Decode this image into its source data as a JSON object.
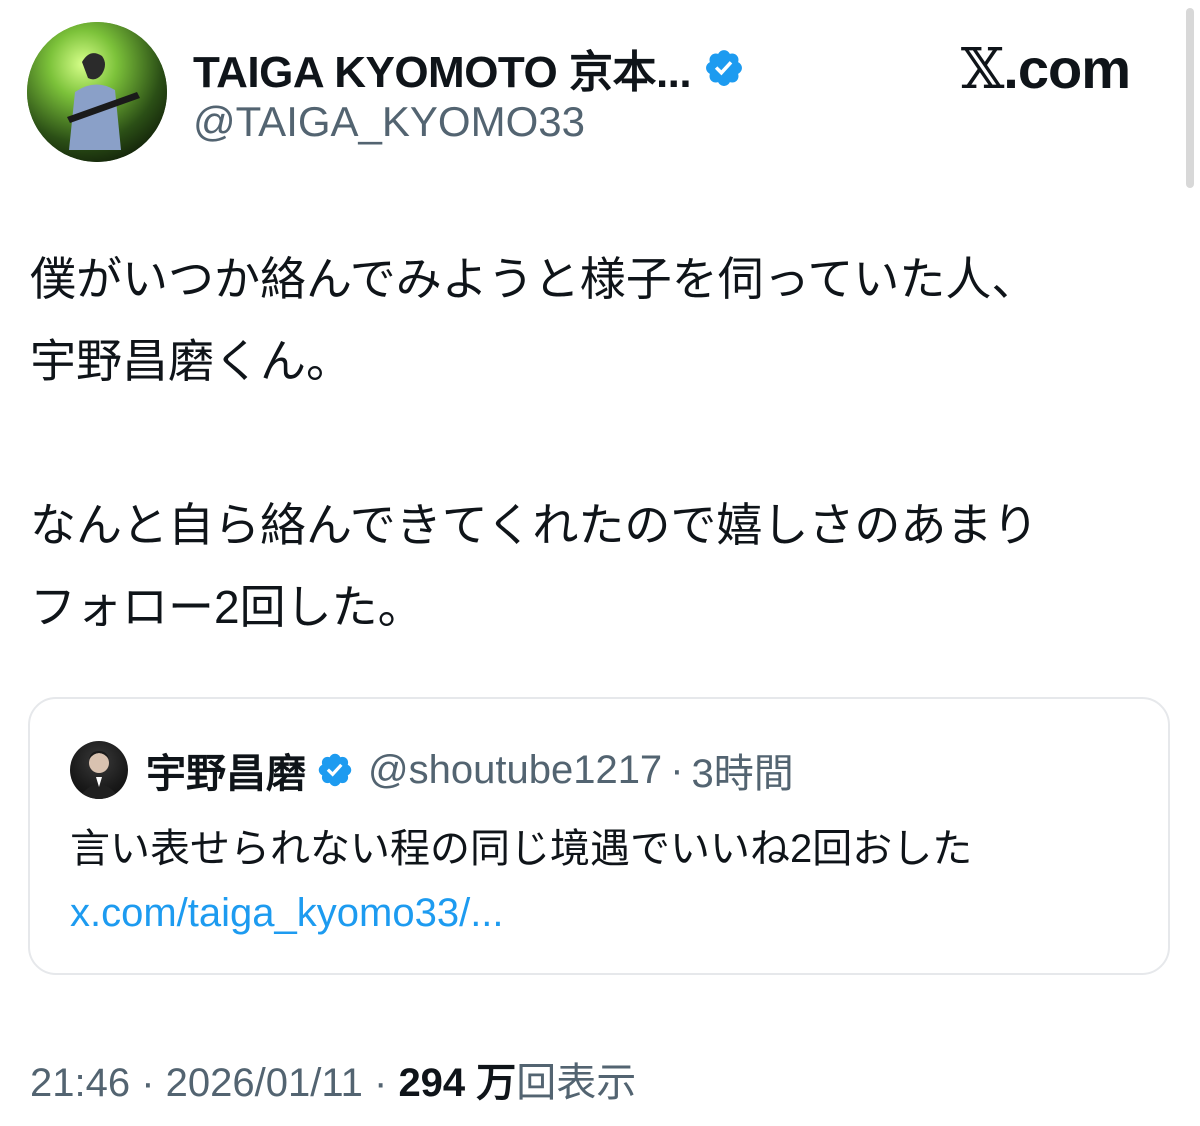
{
  "author": {
    "display_name": "TAIGA KYOMOTO 京本...",
    "handle": "@TAIGA_KYOMO33",
    "verified_icon": "verified-badge-icon",
    "avatar": "avatar-photo"
  },
  "site": {
    "logo_letter": "𝕏",
    "logo_text": ".com"
  },
  "tweet": {
    "line1": "僕がいつか絡んでみようと様子を伺っていた人、",
    "line2": "宇野昌磨くん。",
    "line3": "なんと自ら絡んできてくれたので嬉しさのあまり",
    "line4": "フォロー2回した。"
  },
  "quote": {
    "name": "宇野昌磨",
    "handle": "@shoutube1217",
    "separator": "·",
    "time": "3時間",
    "body": "言い表せられない程の同じ境遇でいいね2回おした",
    "link": "x.com/taiga_kyomo33/..."
  },
  "meta": {
    "time": "21:46",
    "sep1": " · ",
    "date": "2026/01/11",
    "sep2": " · ",
    "views_count": "294 万",
    "views_label": "回表示"
  },
  "colors": {
    "verified": "#1d9bf0",
    "link": "#1d9bf0",
    "secondary_text": "#536471",
    "primary_text": "#0f1419"
  }
}
